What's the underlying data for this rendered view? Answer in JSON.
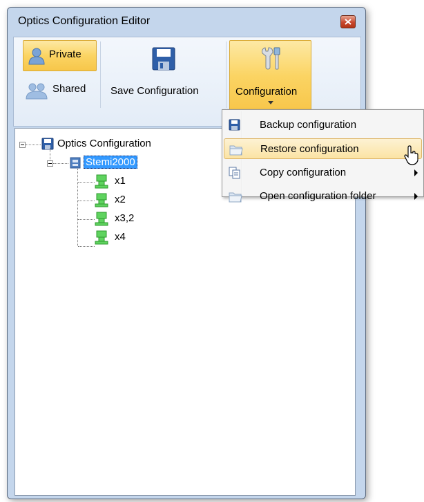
{
  "window": {
    "title": "Optics Configuration Editor"
  },
  "ribbon": {
    "private_label": "Private",
    "shared_label": "Shared",
    "save_label": "Save Configuration",
    "configuration_label": "Configuration"
  },
  "tree": {
    "root": "Optics Configuration",
    "microscope": "Stemi2000",
    "objectives": [
      "x1",
      "x2",
      "x3,2",
      "x4"
    ]
  },
  "menu": {
    "items": [
      {
        "label": "Backup configuration",
        "icon": "floppy-disk-icon"
      },
      {
        "label": "Restore configuration",
        "icon": "folder-icon"
      },
      {
        "label": "Copy configuration",
        "icon": "copy-icon"
      },
      {
        "label": "Open configuration folder",
        "icon": "folder-icon"
      }
    ]
  },
  "colors": {
    "highlight": "#fbd463",
    "selection": "#3399ff",
    "window_frame": "#c4d6ec"
  }
}
